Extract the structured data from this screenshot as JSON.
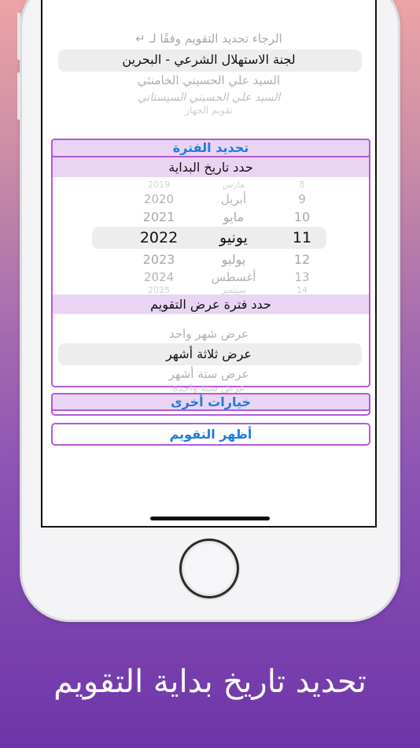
{
  "calendar_picker": {
    "prompt": "الرجاء تحديد التقويم وفقًا لـ ↵",
    "selected": "لجنة الاستهلال الشرعي - البحرين",
    "option_below_1": "السيد علي الحسيني الخامنئي",
    "option_below_2": "السيد علي الحسيني السيستاني",
    "option_below_3": "تقويم الجهاز"
  },
  "period_section": {
    "title": "تحديد الفترة",
    "start_label": "حدد تاريخ البداية",
    "date_wheel": {
      "years": [
        "2019",
        "2020",
        "2021",
        "2022",
        "2023",
        "2024",
        "2025"
      ],
      "months": [
        "مارس",
        "أبريل",
        "مايو",
        "يونيو",
        "يوليو",
        "أغسطس",
        "سبتمبر"
      ],
      "days": [
        "8",
        "9",
        "10",
        "11",
        "12",
        "13",
        "14"
      ]
    },
    "range_label": "حدد فترة عرض التقويم",
    "range_options": {
      "opt1": "عرض شهر واحد",
      "selected": "عرض ثلاثة أشهر",
      "opt3": "عرض ستة أشهر",
      "opt4": "عرض سنة واحدة"
    }
  },
  "other_options_label": "خيارات أخرى",
  "show_calendar_label": "أظهر التقويم",
  "caption": "تحديد تاريخ بداية التقويم",
  "colors": {
    "accent_purple": "#b45ad6",
    "header_fill": "#ead4f3",
    "link_blue": "#1e7be0"
  }
}
